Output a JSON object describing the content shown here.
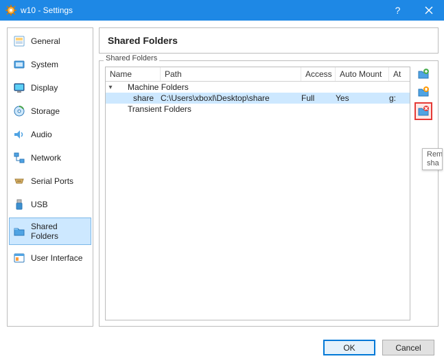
{
  "window": {
    "title": "w10 - Settings"
  },
  "sidebar": {
    "items": [
      {
        "label": "General"
      },
      {
        "label": "System"
      },
      {
        "label": "Display"
      },
      {
        "label": "Storage"
      },
      {
        "label": "Audio"
      },
      {
        "label": "Network"
      },
      {
        "label": "Serial Ports"
      },
      {
        "label": "USB"
      },
      {
        "label": "Shared Folders"
      },
      {
        "label": "User Interface"
      }
    ]
  },
  "main": {
    "page_title": "Shared Folders",
    "group_label": "Shared Folders",
    "columns": {
      "name": "Name",
      "path": "Path",
      "access": "Access",
      "auto": "Auto Mount",
      "at": "At"
    },
    "tree": {
      "machine_folders_label": "Machine Folders",
      "transient_folders_label": "Transient Folders",
      "row": {
        "name": "share",
        "path": "C:\\Users\\xboxl\\Desktop\\share",
        "access": "Full",
        "auto": "Yes",
        "at": "g:"
      }
    },
    "tooltip_line1": "Rem",
    "tooltip_line2": "sha"
  },
  "footer": {
    "ok": "OK",
    "cancel": "Cancel"
  }
}
